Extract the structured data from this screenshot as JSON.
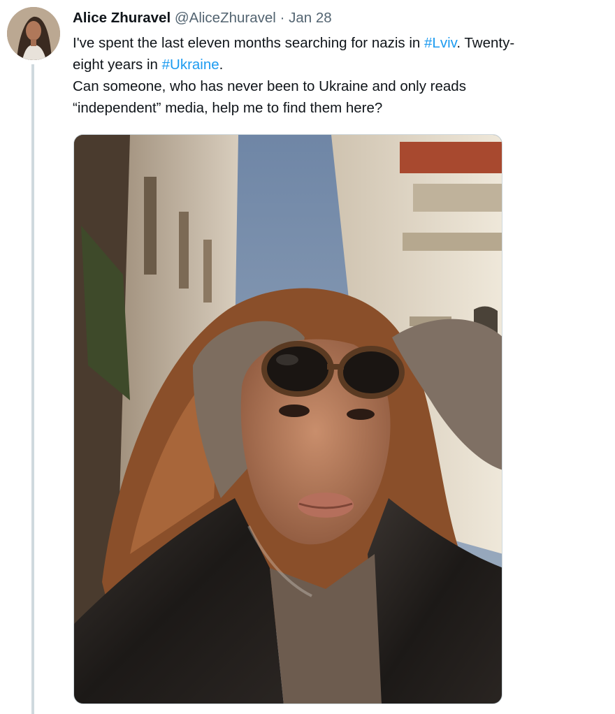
{
  "tweet": {
    "author_name": "Alice Zhuravel",
    "handle": "@AliceZhuravel",
    "separator": "·",
    "date": "Jan 28",
    "text": {
      "l1_pre": "I've spent the last eleven months searching for nazis in ",
      "hashtag_1": "#Lviv",
      "l1_post": ". Twenty-",
      "l2_pre": "eight years in ",
      "hashtag_2": "#Ukraine",
      "l2_post": ".",
      "l3": "Can someone, who has never been to Ukraine and only reads",
      "l4": "“independent” media, help me to find them here?"
    },
    "colors": {
      "text": "#0f1419",
      "secondary": "#536471",
      "link": "#1d9bf0",
      "thread_line": "#cfd9de"
    },
    "media": {
      "alt_subject": "selfie of a woman with sunglasses on her head in a street with old buildings"
    }
  }
}
